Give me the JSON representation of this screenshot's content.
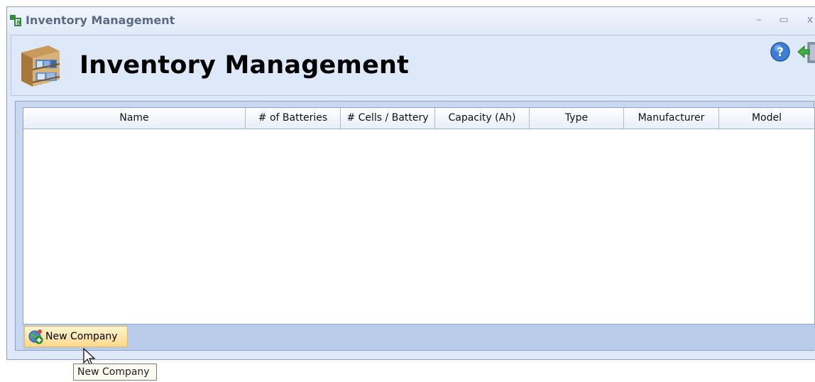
{
  "window": {
    "title": "Inventory Management",
    "minimize_glyph": "–",
    "maximize_glyph": "▭",
    "close_glyph": "x"
  },
  "header": {
    "title": "Inventory Management",
    "logo_icon": "bookshelf-icon",
    "help_icon": "help-icon",
    "exit_icon": "exit-icon"
  },
  "grid": {
    "columns": [
      "Name",
      "# of Batteries",
      "# Cells / Battery",
      "Capacity (Ah)",
      "Type",
      "Manufacturer",
      "Model"
    ],
    "rows": []
  },
  "toolbar": {
    "new_company_label": "New Company",
    "new_company_icon": "globe-add-icon"
  },
  "tooltip": {
    "text": "New Company"
  },
  "colors": {
    "window_bg": "#dde8f8",
    "toolbar_bg": "#b9cdea",
    "button_highlight": "#ffd98b"
  }
}
